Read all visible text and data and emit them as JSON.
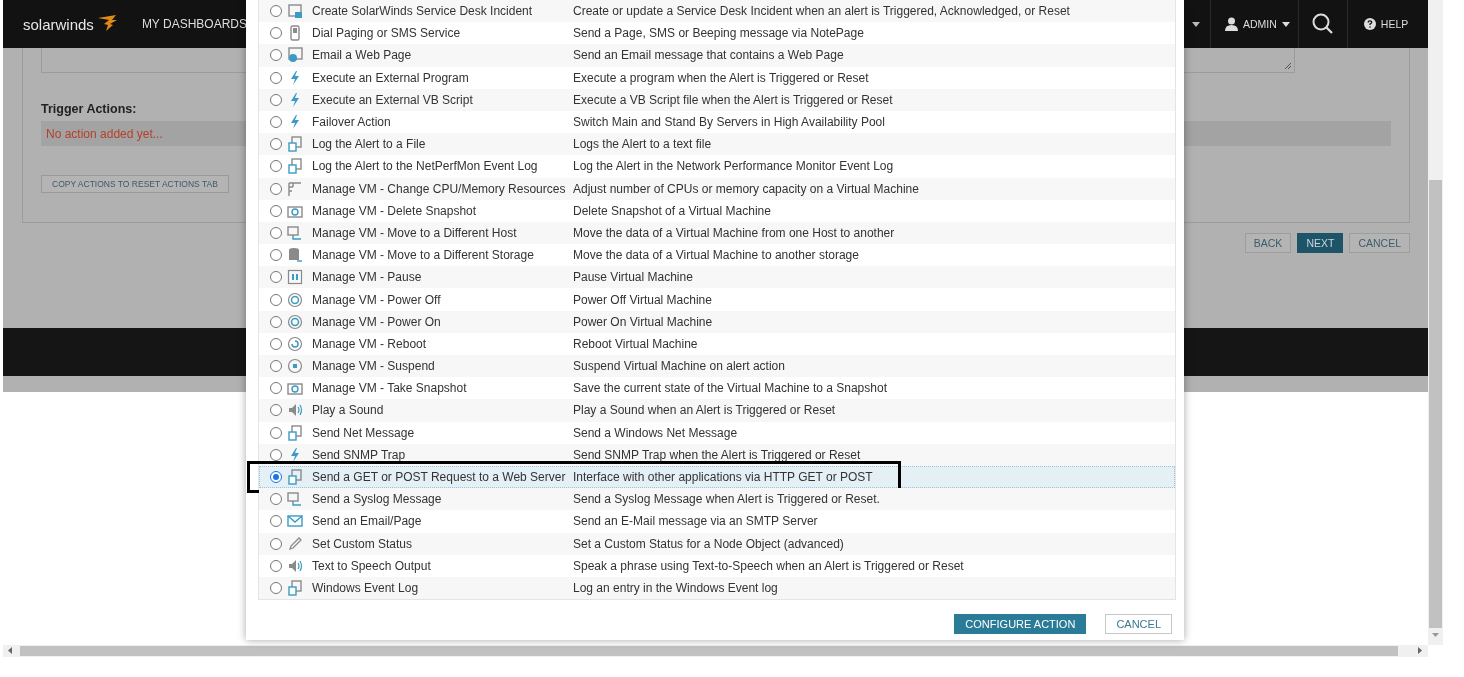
{
  "header": {
    "logo": "solarwinds",
    "nav": [
      {
        "label": "MY DASHBOARDS"
      }
    ],
    "user": "ADMIN",
    "help": "HELP"
  },
  "page": {
    "trigger_label": "Trigger Actions:",
    "empty_actions": "No action added yet...",
    "copy_button": "COPY ACTIONS TO RESET ACTIONS TAB",
    "buttons": [
      {
        "label": "BACK",
        "kind": "default"
      },
      {
        "label": "NEXT",
        "kind": "primary"
      },
      {
        "label": "CANCEL",
        "kind": "default"
      }
    ]
  },
  "dialog": {
    "actions": [
      {
        "name": "Create SolarWinds Service Desk Incident",
        "description": "Create or update a Service Desk Incident when an alert is Triggered, Acknowledged, or Reset",
        "selected": false,
        "highlighted": false
      },
      {
        "name": "Dial Paging or SMS Service",
        "description": "Send a Page, SMS or Beeping message via NotePage",
        "selected": false,
        "highlighted": false
      },
      {
        "name": "Email a Web Page",
        "description": "Send an Email message that contains a Web Page",
        "selected": false,
        "highlighted": false
      },
      {
        "name": "Execute an External Program",
        "description": "Execute a program when the Alert is Triggered or Reset",
        "selected": false,
        "highlighted": false
      },
      {
        "name": "Execute an External VB Script",
        "description": "Execute a VB Script file when the Alert is Triggered or Reset",
        "selected": false,
        "highlighted": false
      },
      {
        "name": "Failover Action",
        "description": "Switch Main and Stand By Servers in High Availability Pool",
        "selected": false,
        "highlighted": false
      },
      {
        "name": "Log the Alert to a File",
        "description": "Logs the Alert to a text file",
        "selected": false,
        "highlighted": false
      },
      {
        "name": "Log the Alert to the NetPerfMon Event Log",
        "description": "Log the Alert in the Network Performance Monitor Event Log",
        "selected": false,
        "highlighted": false
      },
      {
        "name": "Manage VM - Change CPU/Memory Resources",
        "description": "Adjust number of CPUs or memory capacity on a Virtual Machine",
        "selected": false,
        "highlighted": false
      },
      {
        "name": "Manage VM - Delete Snapshot",
        "description": "Delete Snapshot of a Virtual Machine",
        "selected": false,
        "highlighted": false
      },
      {
        "name": "Manage VM - Move to a Different Host",
        "description": "Move the data of a Virtual Machine from one Host to another",
        "selected": false,
        "highlighted": false
      },
      {
        "name": "Manage VM - Move to a Different Storage",
        "description": "Move the data of a Virtual Machine to another storage",
        "selected": false,
        "highlighted": false
      },
      {
        "name": "Manage VM - Pause",
        "description": "Pause Virtual Machine",
        "selected": false,
        "highlighted": false
      },
      {
        "name": "Manage VM - Power Off",
        "description": "Power Off Virtual Machine",
        "selected": false,
        "highlighted": false
      },
      {
        "name": "Manage VM - Power On",
        "description": "Power On Virtual Machine",
        "selected": false,
        "highlighted": false
      },
      {
        "name": "Manage VM - Reboot",
        "description": "Reboot Virtual Machine",
        "selected": false,
        "highlighted": false
      },
      {
        "name": "Manage VM - Suspend",
        "description": "Suspend Virtual Machine on alert action",
        "selected": false,
        "highlighted": false
      },
      {
        "name": "Manage VM - Take Snapshot",
        "description": "Save the current state of the Virtual Machine to a Snapshot",
        "selected": false,
        "highlighted": false
      },
      {
        "name": "Play a Sound",
        "description": "Play a Sound when an Alert is Triggered or Reset",
        "selected": false,
        "highlighted": false
      },
      {
        "name": "Send Net Message",
        "description": "Send a Windows Net Message",
        "selected": false,
        "highlighted": false
      },
      {
        "name": "Send SNMP Trap",
        "description": "Send SNMP Trap when the Alert is Triggered or Reset",
        "selected": false,
        "highlighted": false
      },
      {
        "name": "Send a GET or POST Request to a Web Server",
        "description": "Interface with other applications via HTTP GET or POST",
        "selected": true,
        "highlighted": true
      },
      {
        "name": "Send a Syslog Message",
        "description": "Send a Syslog Message when Alert is Triggered or Reset.",
        "selected": false,
        "highlighted": false
      },
      {
        "name": "Send an Email/Page",
        "description": "Send an E-Mail message via an SMTP Server",
        "selected": false,
        "highlighted": false
      },
      {
        "name": "Set Custom Status",
        "description": "Set a Custom Status for a Node Object (advanced)",
        "selected": false,
        "highlighted": false
      },
      {
        "name": "Text to Speech Output",
        "description": "Speak a phrase using Text-to-Speech when an Alert is Triggered or Reset",
        "selected": false,
        "highlighted": false
      },
      {
        "name": "Windows Event Log",
        "description": "Log an entry in the Windows Event log",
        "selected": false,
        "highlighted": false
      }
    ],
    "buttons": [
      {
        "label": "CONFIGURE ACTION",
        "kind": "primary"
      },
      {
        "label": "CANCEL",
        "kind": "default"
      }
    ]
  }
}
